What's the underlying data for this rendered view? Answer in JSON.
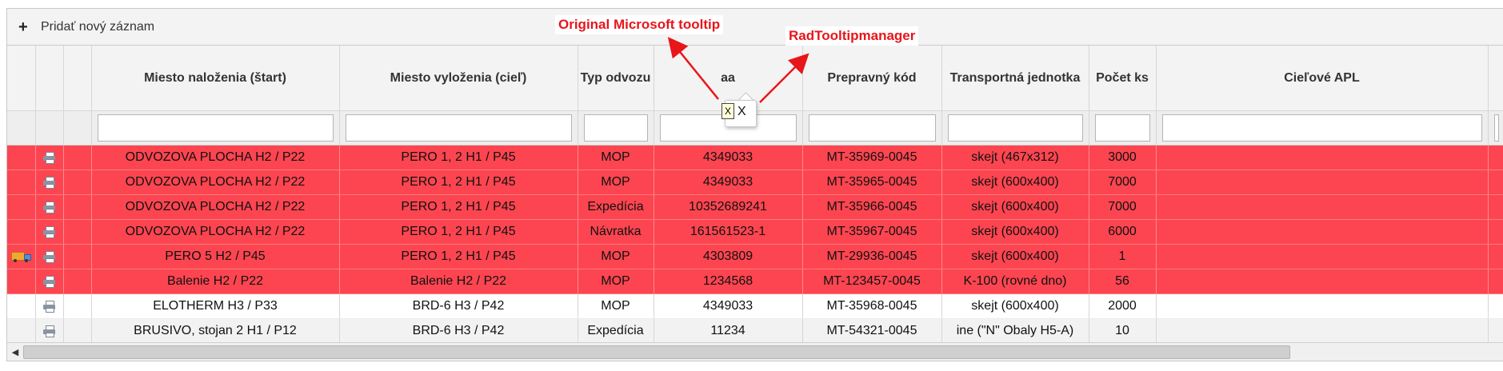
{
  "toolbar": {
    "add_label": "Pridať nový záznam"
  },
  "columns": [
    "Miesto naloženia (štart)",
    "Miesto vyloženia (cieľ)",
    "Typ odvozu",
    "aa",
    "Prepravný kód",
    "Transportná jednotka",
    "Počet ks",
    "Cieľové APL"
  ],
  "rows": [
    {
      "status": "red",
      "truck": false,
      "cells": [
        "ODVOZOVA PLOCHA H2 / P22",
        "PERO 1, 2 H1 / P45",
        "MOP",
        "4349033",
        "MT-35969-0045",
        "skejt (467x312)",
        "3000",
        ""
      ]
    },
    {
      "status": "red",
      "truck": false,
      "cells": [
        "ODVOZOVA PLOCHA H2 / P22",
        "PERO 1, 2 H1 / P45",
        "MOP",
        "4349033",
        "MT-35965-0045",
        "skejt (600x400)",
        "7000",
        ""
      ]
    },
    {
      "status": "red",
      "truck": false,
      "cells": [
        "ODVOZOVA PLOCHA H2 / P22",
        "PERO 1, 2 H1 / P45",
        "Expedícia",
        "10352689241",
        "MT-35966-0045",
        "skejt (600x400)",
        "7000",
        ""
      ]
    },
    {
      "status": "red",
      "truck": false,
      "cells": [
        "ODVOZOVA PLOCHA H2 / P22",
        "PERO 1, 2 H1 / P45",
        "Návratka",
        "161561523-1",
        "MT-35967-0045",
        "skejt (600x400)",
        "6000",
        ""
      ]
    },
    {
      "status": "red",
      "truck": true,
      "cells": [
        "PERO 5 H2 / P45",
        "PERO 1, 2 H1 / P45",
        "MOP",
        "4303809",
        "MT-29936-0045",
        "skejt (600x400)",
        "1",
        ""
      ]
    },
    {
      "status": "red",
      "truck": false,
      "cells": [
        "Balenie H2 / P22",
        "Balenie H2 / P22",
        "MOP",
        "1234568",
        "MT-123457-0045",
        "K-100 (rovné dno)",
        "56",
        ""
      ]
    },
    {
      "status": "white",
      "truck": false,
      "cells": [
        "ELOTHERM H3 / P33",
        "BRD-6 H3 / P42",
        "MOP",
        "4349033",
        "MT-35968-0045",
        "skejt (600x400)",
        "2000",
        ""
      ]
    },
    {
      "status": "gray",
      "truck": false,
      "cells": [
        "BRUSIVO, stojan 2 H1 / P12",
        "BRD-6 H3 / P42",
        "Expedícia",
        "11234",
        "MT-54321-0045",
        "ine (\"N\" Obaly H5-A)",
        "10",
        ""
      ]
    }
  ],
  "annotations": {
    "original_tooltip": "Original Microsoft tooltip",
    "rad_tooltip": "RadTooltipmanager",
    "tooltip_x": "X",
    "small_tooltip_x": "X"
  },
  "colors": {
    "error_row": "#fc4550",
    "annotation": "#e8151b"
  }
}
